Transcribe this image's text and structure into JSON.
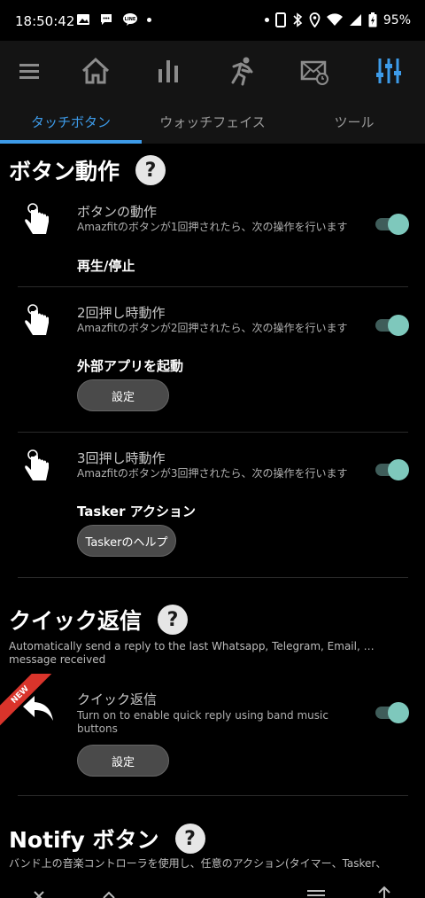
{
  "status_bar": {
    "time": "18:50:42",
    "battery": "95%"
  },
  "nav": {
    "items": [
      "menu-icon",
      "home-icon",
      "chart-icon",
      "run-icon",
      "mail-icon",
      "sliders-icon"
    ],
    "active_color": "#3d9be9"
  },
  "tabs": [
    {
      "label": "タッチボタン",
      "active": true
    },
    {
      "label": "ウォッチフェイス",
      "active": false
    },
    {
      "label": "ツール",
      "active": false
    }
  ],
  "button_section": {
    "title": "ボタン動作",
    "items": [
      {
        "title": "ボタンの動作",
        "subtitle": "Amazfitのボタンが1回押されたら、次の操作を行います",
        "value": "再生/停止",
        "enabled": true
      },
      {
        "title": "2回押し時動作",
        "subtitle": "Amazfitのボタンが2回押されたら、次の操作を行います",
        "value": "外部アプリを起動",
        "button": "設定",
        "enabled": true
      },
      {
        "title": "3回押し時動作",
        "subtitle": "Amazfitのボタンが3回押されたら、次の操作を行います",
        "value": "Tasker アクション",
        "button": "Taskerのヘルプ",
        "enabled": true
      }
    ]
  },
  "quick_reply_section": {
    "title": "クイック返信",
    "description": "Automatically send a reply to the last Whatsapp, Telegram, Email, … message received",
    "ribbon": "NEW",
    "item": {
      "title": "クイック返信",
      "subtitle": "Turn on to enable quick reply using band music buttons",
      "button": "設定",
      "enabled": true
    }
  },
  "notify_section": {
    "title": "Notify ボタン",
    "description": "バンド上の音楽コントローラを使用し、任意のアクション(タイマー、Tasker、"
  }
}
